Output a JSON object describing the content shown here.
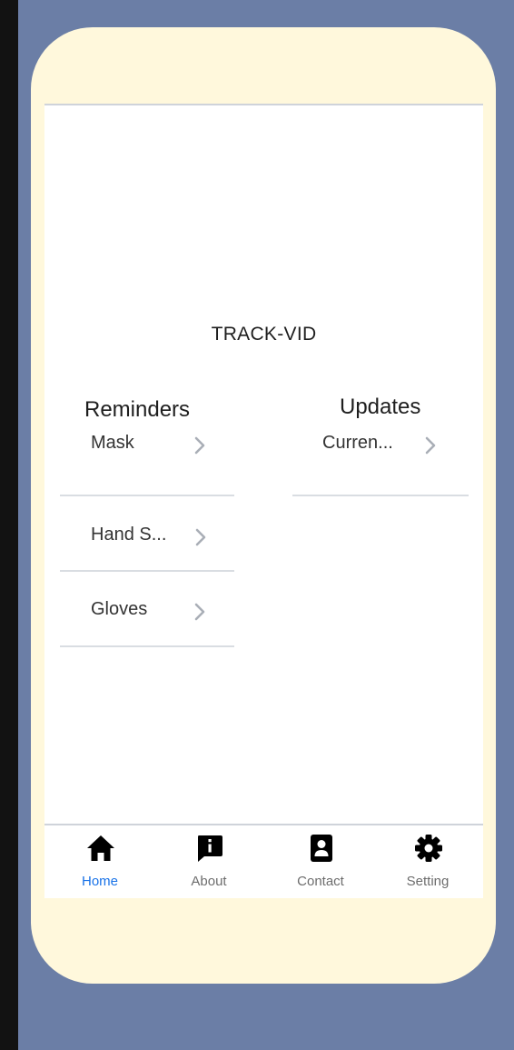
{
  "app": {
    "title": "TRACK-VID"
  },
  "reminders": {
    "title": "Reminders",
    "items": [
      {
        "label": "Mask"
      },
      {
        "label": "Hand S..."
      },
      {
        "label": "Gloves"
      }
    ]
  },
  "updates": {
    "title": "Updates",
    "items": [
      {
        "label": "Curren..."
      }
    ]
  },
  "tabs": [
    {
      "label": "Home",
      "icon": "home-icon",
      "active": true
    },
    {
      "label": "About",
      "icon": "info-chat-icon",
      "active": false
    },
    {
      "label": "Contact",
      "icon": "contact-icon",
      "active": false
    },
    {
      "label": "Setting",
      "icon": "gear-icon",
      "active": false
    }
  ],
  "colors": {
    "background": "#6b7ea6",
    "phone_frame": "#fff8dc",
    "screen": "#ffffff",
    "active_tab": "#1a73e8",
    "inactive_tab": "#6d6d6d"
  }
}
